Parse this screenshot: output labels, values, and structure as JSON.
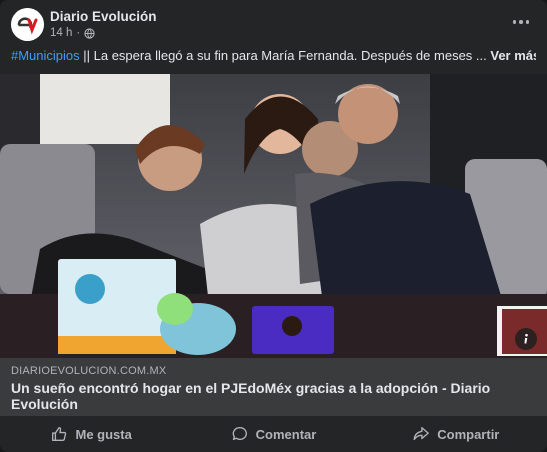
{
  "post": {
    "page_name": "Diario Evolución",
    "time": "14 h",
    "hashtag": "#Municipios",
    "text": " || La espera llegó a su fin para María Fernanda. Después de meses ...",
    "see_more": "Ver más",
    "avatar_icon": "diario-evolucion-logo",
    "privacy_icon": "globe-icon"
  },
  "photo": {
    "alt_icon": "info-icon"
  },
  "link_preview": {
    "domain": "DIARIOEVOLUCION.COM.MX",
    "title": "Un sueño encontró hogar en el PJEdoMéx gracias a la adopción - Diario Evolución"
  },
  "actions": {
    "like": "Me gusta",
    "comment": "Comentar",
    "share": "Compartir"
  },
  "colors": {
    "card_bg": "#242526",
    "link_bg": "#3a3b3c",
    "hashtag": "#4599ff",
    "text_secondary": "#b0b3b8",
    "logo_red": "#d71920"
  }
}
